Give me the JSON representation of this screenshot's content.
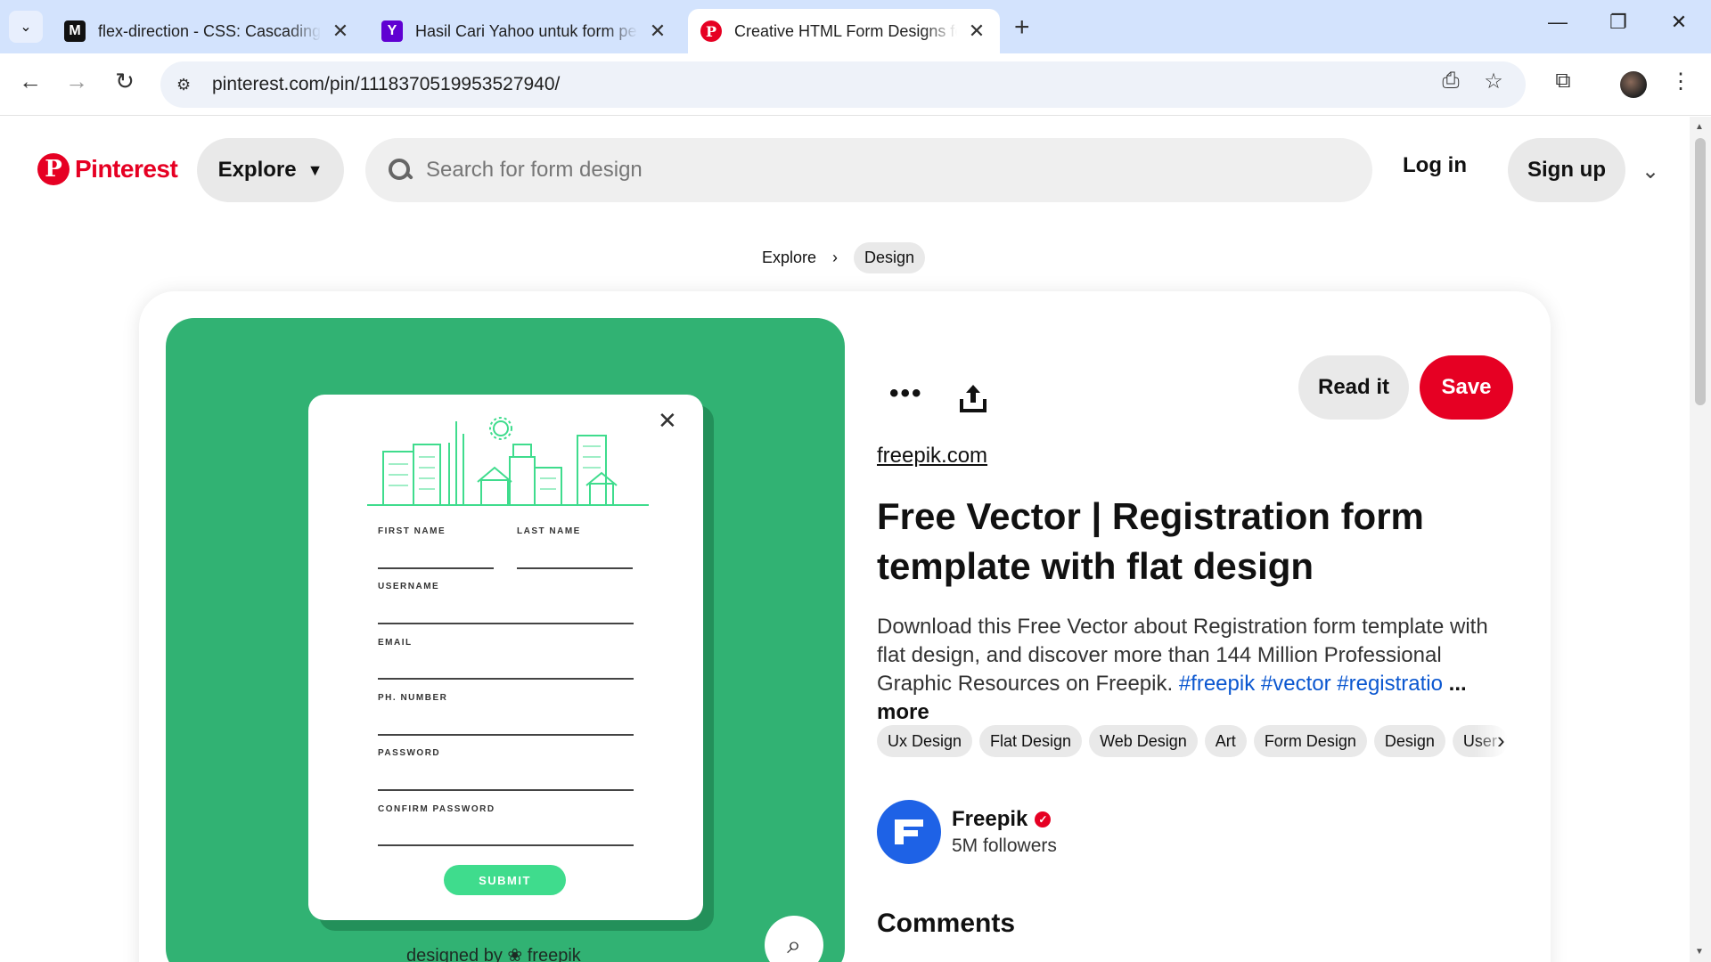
{
  "browser": {
    "tabs": [
      {
        "title": "flex-direction - CSS: Cascading",
        "favicon": "mdn-icon"
      },
      {
        "title": "Hasil Cari Yahoo untuk form pe",
        "favicon": "yahoo-icon"
      },
      {
        "title": "Creative HTML Form Designs fo",
        "favicon": "pinterest-icon"
      }
    ],
    "url": "pinterest.com/pin/1118370519953527940/",
    "new_tab": "+",
    "window_controls": {
      "minimize": "—",
      "restore": "❐",
      "close": "✕"
    }
  },
  "header": {
    "logo_text": "Pinterest",
    "explore_label": "Explore",
    "search_placeholder": "Search for form design",
    "login_label": "Log in",
    "signup_label": "Sign up"
  },
  "breadcrumb": {
    "items": [
      "Explore",
      "Design"
    ]
  },
  "pin": {
    "image": {
      "labels": {
        "first_name": "FIRST NAME",
        "last_name": "LAST NAME",
        "username": "USERNAME",
        "email": "EMAIL",
        "phone": "PH. NUMBER",
        "password": "PASSWORD",
        "confirm_password": "CONFIRM PASSWORD"
      },
      "submit": "SUBMIT",
      "credit": "designed by ❀ freepik",
      "bg_color": "#31b273",
      "accent_color": "#3fdc8d"
    },
    "read_it_label": "Read it",
    "save_label": "Save",
    "source": "freepik.com",
    "title": "Free Vector | Registration form template with flat design",
    "description": "Download this Free Vector about Registration form template with flat design, and discover more than 144 Million Professional Graphic Resources on Freepik.",
    "hashtags": "#freepik #vector #registratio",
    "more_label": "... more",
    "chips": [
      "Ux Design",
      "Flat Design",
      "Web Design",
      "Art",
      "Form Design",
      "Design",
      "User"
    ],
    "creator": {
      "name": "Freepik",
      "followers": "5M followers"
    },
    "comments_heading": "Comments"
  },
  "colors": {
    "brand": "#e60023",
    "tab_bar": "#d3e3fd",
    "link": "#0b57d0"
  }
}
